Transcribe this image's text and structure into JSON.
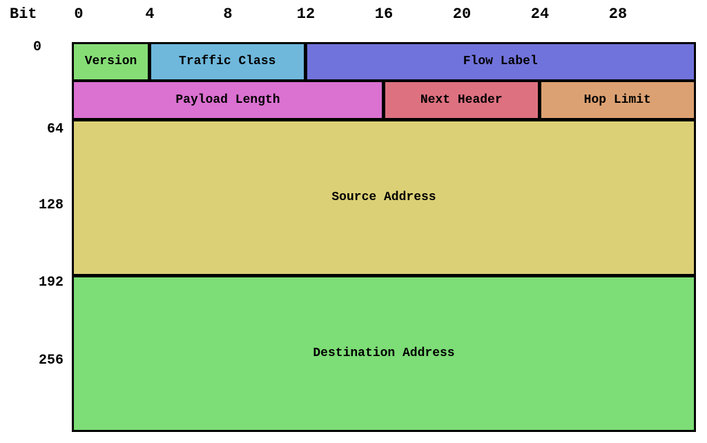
{
  "header": {
    "bit_label": "Bit"
  },
  "x_ticks": [
    "0",
    "4",
    "8",
    "12",
    "16",
    "20",
    "24",
    "28"
  ],
  "y_ticks": [
    "0",
    "64",
    "128",
    "192",
    "256"
  ],
  "total_bits_per_row": 32,
  "fields": [
    {
      "name": "version",
      "label": "Version",
      "start_bit": 0,
      "bits": 4,
      "color": "#86dd76"
    },
    {
      "name": "traffic-class",
      "label": "Traffic Class",
      "start_bit": 4,
      "bits": 8,
      "color": "#6fb8dc"
    },
    {
      "name": "flow-label",
      "label": "Flow Label",
      "start_bit": 12,
      "bits": 20,
      "color": "#7173dc"
    },
    {
      "name": "payload-length",
      "label": "Payload Length",
      "start_bit": 32,
      "bits": 16,
      "color": "#db71d1"
    },
    {
      "name": "next-header",
      "label": "Next Header",
      "start_bit": 48,
      "bits": 8,
      "color": "#dd7180"
    },
    {
      "name": "hop-limit",
      "label": "Hop Limit",
      "start_bit": 56,
      "bits": 8,
      "color": "#dca172"
    },
    {
      "name": "source-address",
      "label": "Source Address",
      "start_bit": 64,
      "bits": 128,
      "color": "#dcd076"
    },
    {
      "name": "destination-address",
      "label": "Destination Address",
      "start_bit": 192,
      "bits": 128,
      "color": "#7ddd76"
    }
  ]
}
